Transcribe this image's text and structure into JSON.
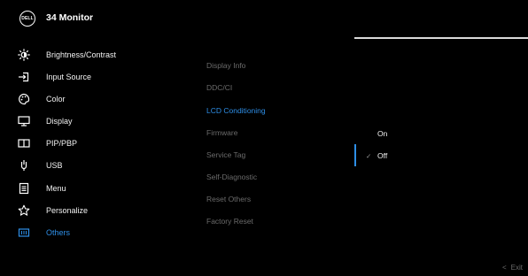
{
  "header": {
    "logo_text": "DELL",
    "title": "34 Monitor"
  },
  "menu": {
    "items": [
      {
        "label": "Brightness/Contrast",
        "icon": "brightness-icon"
      },
      {
        "label": "Input Source",
        "icon": "input-source-icon"
      },
      {
        "label": "Color",
        "icon": "color-palette-icon"
      },
      {
        "label": "Display",
        "icon": "display-monitor-icon"
      },
      {
        "label": "PIP/PBP",
        "icon": "pip-pbp-icon"
      },
      {
        "label": "USB",
        "icon": "usb-icon"
      },
      {
        "label": "Menu",
        "icon": "menu-list-icon"
      },
      {
        "label": "Personalize",
        "icon": "star-icon"
      },
      {
        "label": "Others",
        "icon": "others-icon",
        "active": true
      }
    ]
  },
  "submenu": {
    "items": [
      {
        "label": "Display Info"
      },
      {
        "label": "DDC/CI"
      },
      {
        "label": "LCD Conditioning",
        "active": true
      },
      {
        "label": "Firmware"
      },
      {
        "label": "Service Tag"
      },
      {
        "label": "Self-Diagnostic"
      },
      {
        "label": "Reset Others"
      },
      {
        "label": "Factory Reset"
      }
    ]
  },
  "options": {
    "items": [
      {
        "label": "On"
      },
      {
        "label": "Off",
        "selected": true
      }
    ],
    "check_glyph": "✓"
  },
  "footer": {
    "exit_label": "Exit",
    "exit_glyph": "<"
  },
  "colors": {
    "accent": "#2e8ee6",
    "text": "#f2f2f2",
    "muted": "#6b6b6b",
    "background": "#000000"
  }
}
